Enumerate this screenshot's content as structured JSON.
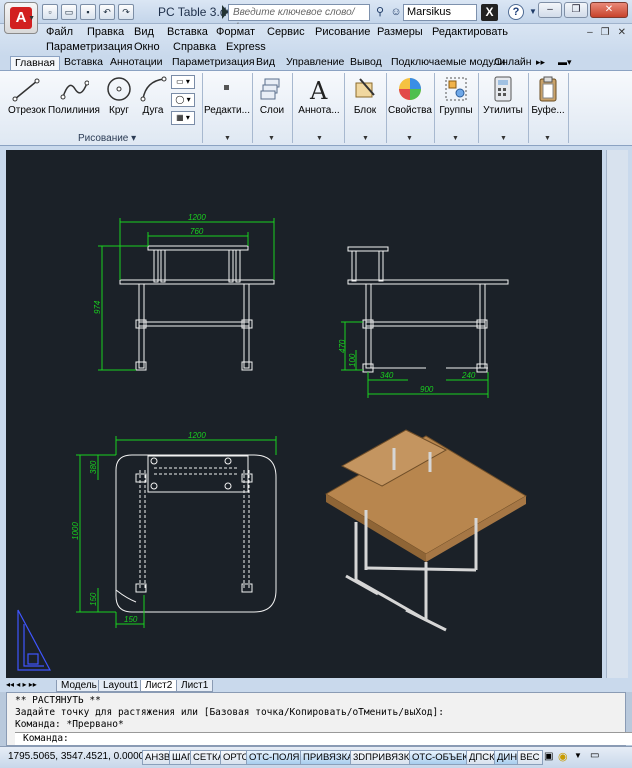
{
  "window": {
    "title": "PC Table 3.dwg",
    "search_placeholder": "Введите ключевое слово/фразу",
    "user": "Marsikus",
    "minimize": "‒",
    "restore": "❐",
    "close": "✕"
  },
  "menu": {
    "row1": [
      "Файл",
      "Правка",
      "Вид",
      "Вставка",
      "Формат",
      "Сервис",
      "Рисование",
      "Размеры",
      "Редактировать"
    ],
    "row2": [
      "Параметризация",
      "Окно",
      "Справка",
      "Express"
    ]
  },
  "ribbon_tabs": [
    "Главная",
    "Вставка",
    "Аннотации",
    "Параметризация",
    "Вид",
    "Управление",
    "Вывод",
    "Подключаемые модули",
    "Онлайн"
  ],
  "ribbon": {
    "tools": {
      "line": "Отрезок",
      "polyline": "Полилиния",
      "circle": "Круг",
      "arc": "Дуга",
      "modify": "Редакти...",
      "layers": "Слои",
      "annotation": "Аннота...",
      "block": "Блок",
      "properties": "Свойства",
      "groups": "Группы",
      "utilities": "Утилиты",
      "clipboard": "Буфе..."
    },
    "draw_panel_label": "Рисование"
  },
  "drawing": {
    "front_view": {
      "overall_width": "1200",
      "top_shelf_width": "760",
      "height": "974"
    },
    "side_view": {
      "height": "470",
      "small_height": "100",
      "foot_a": "340",
      "foot_b": "240",
      "depth": "900"
    },
    "plan_view": {
      "width": "1200",
      "depth": "1000",
      "top_offset": "380",
      "bottom_offset": "150",
      "side_offset": "150"
    }
  },
  "layout_tabs": [
    "Модель",
    "Layout1",
    "Лист2",
    "Лист1"
  ],
  "active_layout_tab": "Лист2",
  "command": {
    "line1": "** РАСТЯНУТЬ **",
    "line2": "Задайте точку для растяжения или [Базовая точка/Копировать/оТменить/выХод]:",
    "line3": "Команда: *Прервано*",
    "prompt": "Команда:"
  },
  "status": {
    "coords": "1795.5065, 3547.4521, 0.0000",
    "buttons": [
      "АНЗВ",
      "ШАГ",
      "СЕТКА",
      "ОРТО",
      "ОТС-ПОЛЯР",
      "ПРИВЯЗКА",
      "3DПРИВЯЗКА",
      "ОТС-ОБЪЕКТ",
      "ДПСК",
      "ДИН",
      "ВЕС"
    ]
  },
  "colors": {
    "canvas_bg": "#1b2128",
    "dim_green": "#19d11f",
    "geometry_white": "#f2f2f2",
    "wood": "#b8864e"
  }
}
